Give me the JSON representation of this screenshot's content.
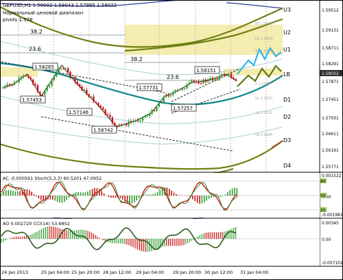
{
  "header": {
    "symbol_line": "GBPUSD,H1  1.58002  1.58043  1.57995  1.58022",
    "subtitle_1": "Нормальный ценовой диапазон",
    "subtitle_2": "pivots 1.578"
  },
  "fib_labels": [
    "38.2",
    "23.6",
    "38.2",
    "23.6"
  ],
  "price_tags": [
    "1.58265",
    "1.57453",
    "1.57146",
    "1.56742",
    "1.57731",
    "1.57257",
    "1.58151"
  ],
  "level_labels": [
    "U3",
    "U2",
    "U1",
    "LB",
    "D1",
    "D2",
    "D3",
    "D4"
  ],
  "faint_levels": [
    "R3 1.5933",
    "R2 1.5843",
    "R1 1.5816",
    "P 1.5787",
    "S1 1.5752",
    "S2 1.5720",
    "S3 1.5685"
  ],
  "price_axis": [
    "1.59512",
    "1.59131",
    "1.58711",
    "1.58291",
    "1.57871",
    "1.57451",
    "1.57031",
    "1.56611",
    "1.56191",
    "1.55771"
  ],
  "current_price_tag": "1.58022",
  "time_axis": [
    "24 Jan 2013",
    "25 Jan 04:00",
    "25 Jan 20:00",
    "28 Jan 12:00",
    "29 Jan 04:00",
    "29 Jan 20:00",
    "30 Jan 12:00",
    "31 Jan 04:00"
  ],
  "ac_panel": {
    "label": "AC -0.000561  Stoch(5,3,3) 60.5201 47.0952",
    "axis": [
      "0.001522",
      "0.00",
      "-0.001981"
    ],
    "stoch_levels": [
      "80",
      "50",
      "20"
    ]
  },
  "ao_panel": {
    "label": "AO 0.002720  CCI(14) 53.6852",
    "axis": [
      "0.00345",
      "0.00",
      "-0.007102"
    ]
  },
  "colors": {
    "up_candle": "#2e9a2e",
    "down_candle": "#c81414",
    "teal_ma": "#1a8a8a",
    "olive_band": "#7a8a16",
    "navy_band": "#2b3a9a",
    "forecast_blue": "#2fb6ee",
    "forecast_olive": "#5f7a12",
    "zone_fill": "#f5ecb0"
  }
}
